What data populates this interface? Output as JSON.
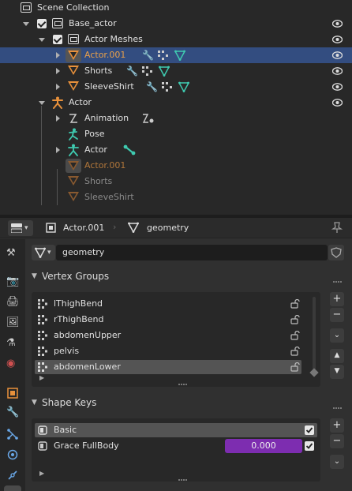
{
  "outliner": {
    "scene_collection": "Scene Collection",
    "base_actor": "Base_actor",
    "actor_meshes": "Actor Meshes",
    "actor001": "Actor.001",
    "shorts": "Shorts",
    "sleeveshirt": "SleeveShirt",
    "actor": "Actor",
    "animation": "Animation",
    "pose": "Pose",
    "actor_armature": "Actor",
    "actor001_dim": "Actor.001",
    "shorts_dim": "Shorts",
    "sleeveshirt_dim": "SleeveShirt"
  },
  "properties": {
    "breadcrumb_object": "Actor.001",
    "breadcrumb_data": "geometry",
    "datablock_name": "geometry",
    "vertex_groups": {
      "title": "Vertex Groups",
      "items": [
        "lThighBend",
        "rThighBend",
        "abdomenUpper",
        "pelvis",
        "abdomenLower"
      ],
      "selected_index": 4
    },
    "shape_keys": {
      "title": "Shape Keys",
      "items": [
        {
          "name": "Basic",
          "value": ""
        },
        {
          "name": "Grace FullBody",
          "value": "0.000"
        }
      ],
      "selected_index": 0
    }
  },
  "colors": {
    "selection": "#334d80",
    "mesh_orange": "#e8913b",
    "data_green": "#3fcab0",
    "value_purple": "#7d2db0",
    "wrench_blue": "#6aa8e8"
  }
}
